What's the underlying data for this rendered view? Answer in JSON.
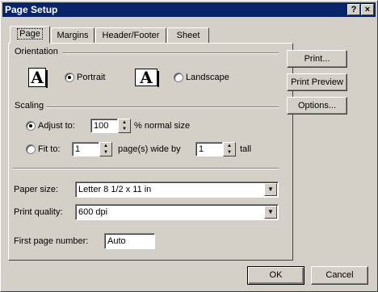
{
  "window": {
    "title": "Page Setup",
    "help_label": "?",
    "close_label": "×"
  },
  "tabs": [
    {
      "label": "Page"
    },
    {
      "label": "Margins"
    },
    {
      "label": "Header/Footer"
    },
    {
      "label": "Sheet"
    }
  ],
  "orientation": {
    "group_label": "Orientation",
    "portrait_label": "Portrait",
    "landscape_label": "Landscape",
    "selected": "Portrait",
    "icon_letter": "A"
  },
  "scaling": {
    "group_label": "Scaling",
    "adjust_label": "Adjust to:",
    "adjust_value": "100",
    "adjust_suffix": "% normal size",
    "fit_label": "Fit to:",
    "fit_wide_value": "1",
    "fit_wide_suffix": "page(s) wide by",
    "fit_tall_value": "1",
    "fit_tall_suffix": "tall",
    "selected": "Adjust to"
  },
  "paper_size": {
    "label": "Paper size:",
    "value": "Letter 8 1/2 x 11 in"
  },
  "print_quality": {
    "label": "Print quality:",
    "value": "600 dpi"
  },
  "first_page": {
    "label": "First page number:",
    "value": "Auto"
  },
  "side_buttons": {
    "print": "Print...",
    "preview": "Print Preview",
    "options": "Options..."
  },
  "footer_buttons": {
    "ok": "OK",
    "cancel": "Cancel"
  }
}
